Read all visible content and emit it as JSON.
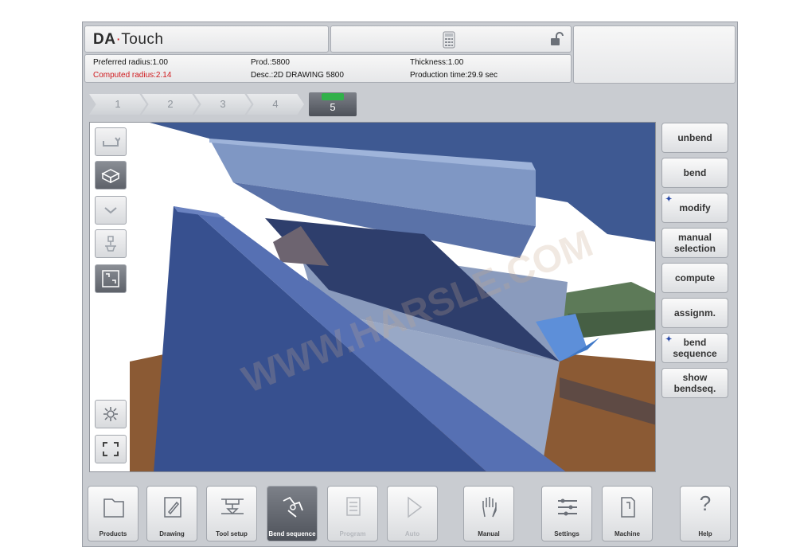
{
  "header": {
    "logo_brand": "DA",
    "logo_dot": "·",
    "logo_product": "Touch"
  },
  "info": {
    "preferred_radius": "Preferred radius:1.00",
    "computed_radius": "Computed radius:2.14",
    "prod": "Prod.:5800",
    "desc": "Desc.:2D DRAWING 5800",
    "thickness": "Thickness:1.00",
    "production_time": "Production time:29.9 sec"
  },
  "steps": [
    "1",
    "2",
    "3",
    "4",
    "5"
  ],
  "active_step": "5",
  "right_buttons": {
    "unbend": "unbend",
    "bend": "bend",
    "modify": "modify",
    "manual_selection": "manual selection",
    "compute": "compute",
    "assignm": "assignm.",
    "bend_sequence": "bend sequence",
    "show_bendseq": "show bendseq."
  },
  "bottom_nav": {
    "products": "Products",
    "drawing": "Drawing",
    "tool_setup": "Tool setup",
    "bend_sequence": "Bend sequence",
    "program": "Program",
    "auto": "Auto",
    "manual": "Manual",
    "settings": "Settings",
    "machine": "Machine",
    "help": "Help"
  },
  "watermark": "WWW.HARSLE.COM",
  "colors": {
    "accent_green": "#31b14a",
    "alert_red": "#d0191d",
    "active_dark": "#5e626a"
  }
}
